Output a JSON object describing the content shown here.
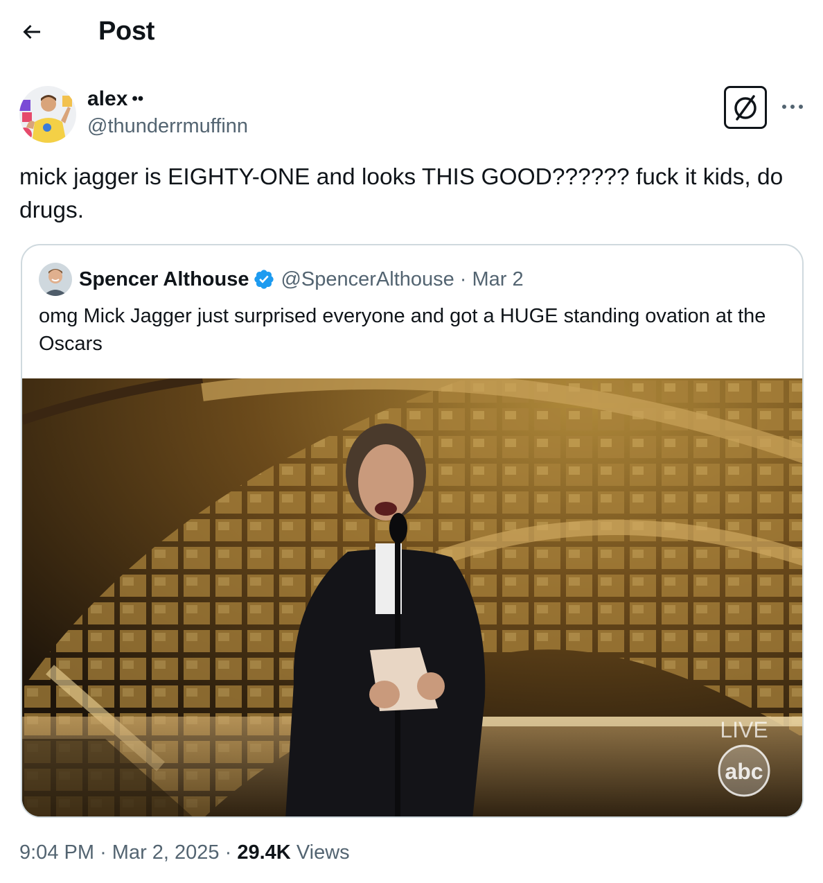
{
  "header": {
    "back_icon": "arrow-left-icon",
    "title": "Post"
  },
  "author": {
    "display_name": "alex",
    "name_suffix": "••",
    "handle": "@thunderrmuffinn",
    "avatar_icon": "user-avatar",
    "grok_icon": "grok-icon",
    "more_icon": "more-horizontal-icon"
  },
  "tweet": {
    "text": "mick jagger is EIGHTY-ONE and looks THIS GOOD?????? fuck it kids, do drugs."
  },
  "quote": {
    "display_name": "Spencer Althouse",
    "verified_icon": "verified-badge-icon",
    "handle": "@SpencerAlthouse",
    "separator": "·",
    "date": "Mar 2",
    "text": "omg Mick Jagger just surprised everyone and got a HUGE standing ovation at the Oscars",
    "media": {
      "live_label": "LIVE",
      "network_logo": "abc"
    }
  },
  "meta": {
    "time": "9:04 PM",
    "separator": "·",
    "date": "Mar 2, 2025",
    "views_count": "29.4K",
    "views_label": "Views"
  },
  "colors": {
    "text_primary": "#0f1419",
    "text_secondary": "#536471",
    "border": "#cfd9de",
    "verified_blue": "#1d9bf0"
  }
}
